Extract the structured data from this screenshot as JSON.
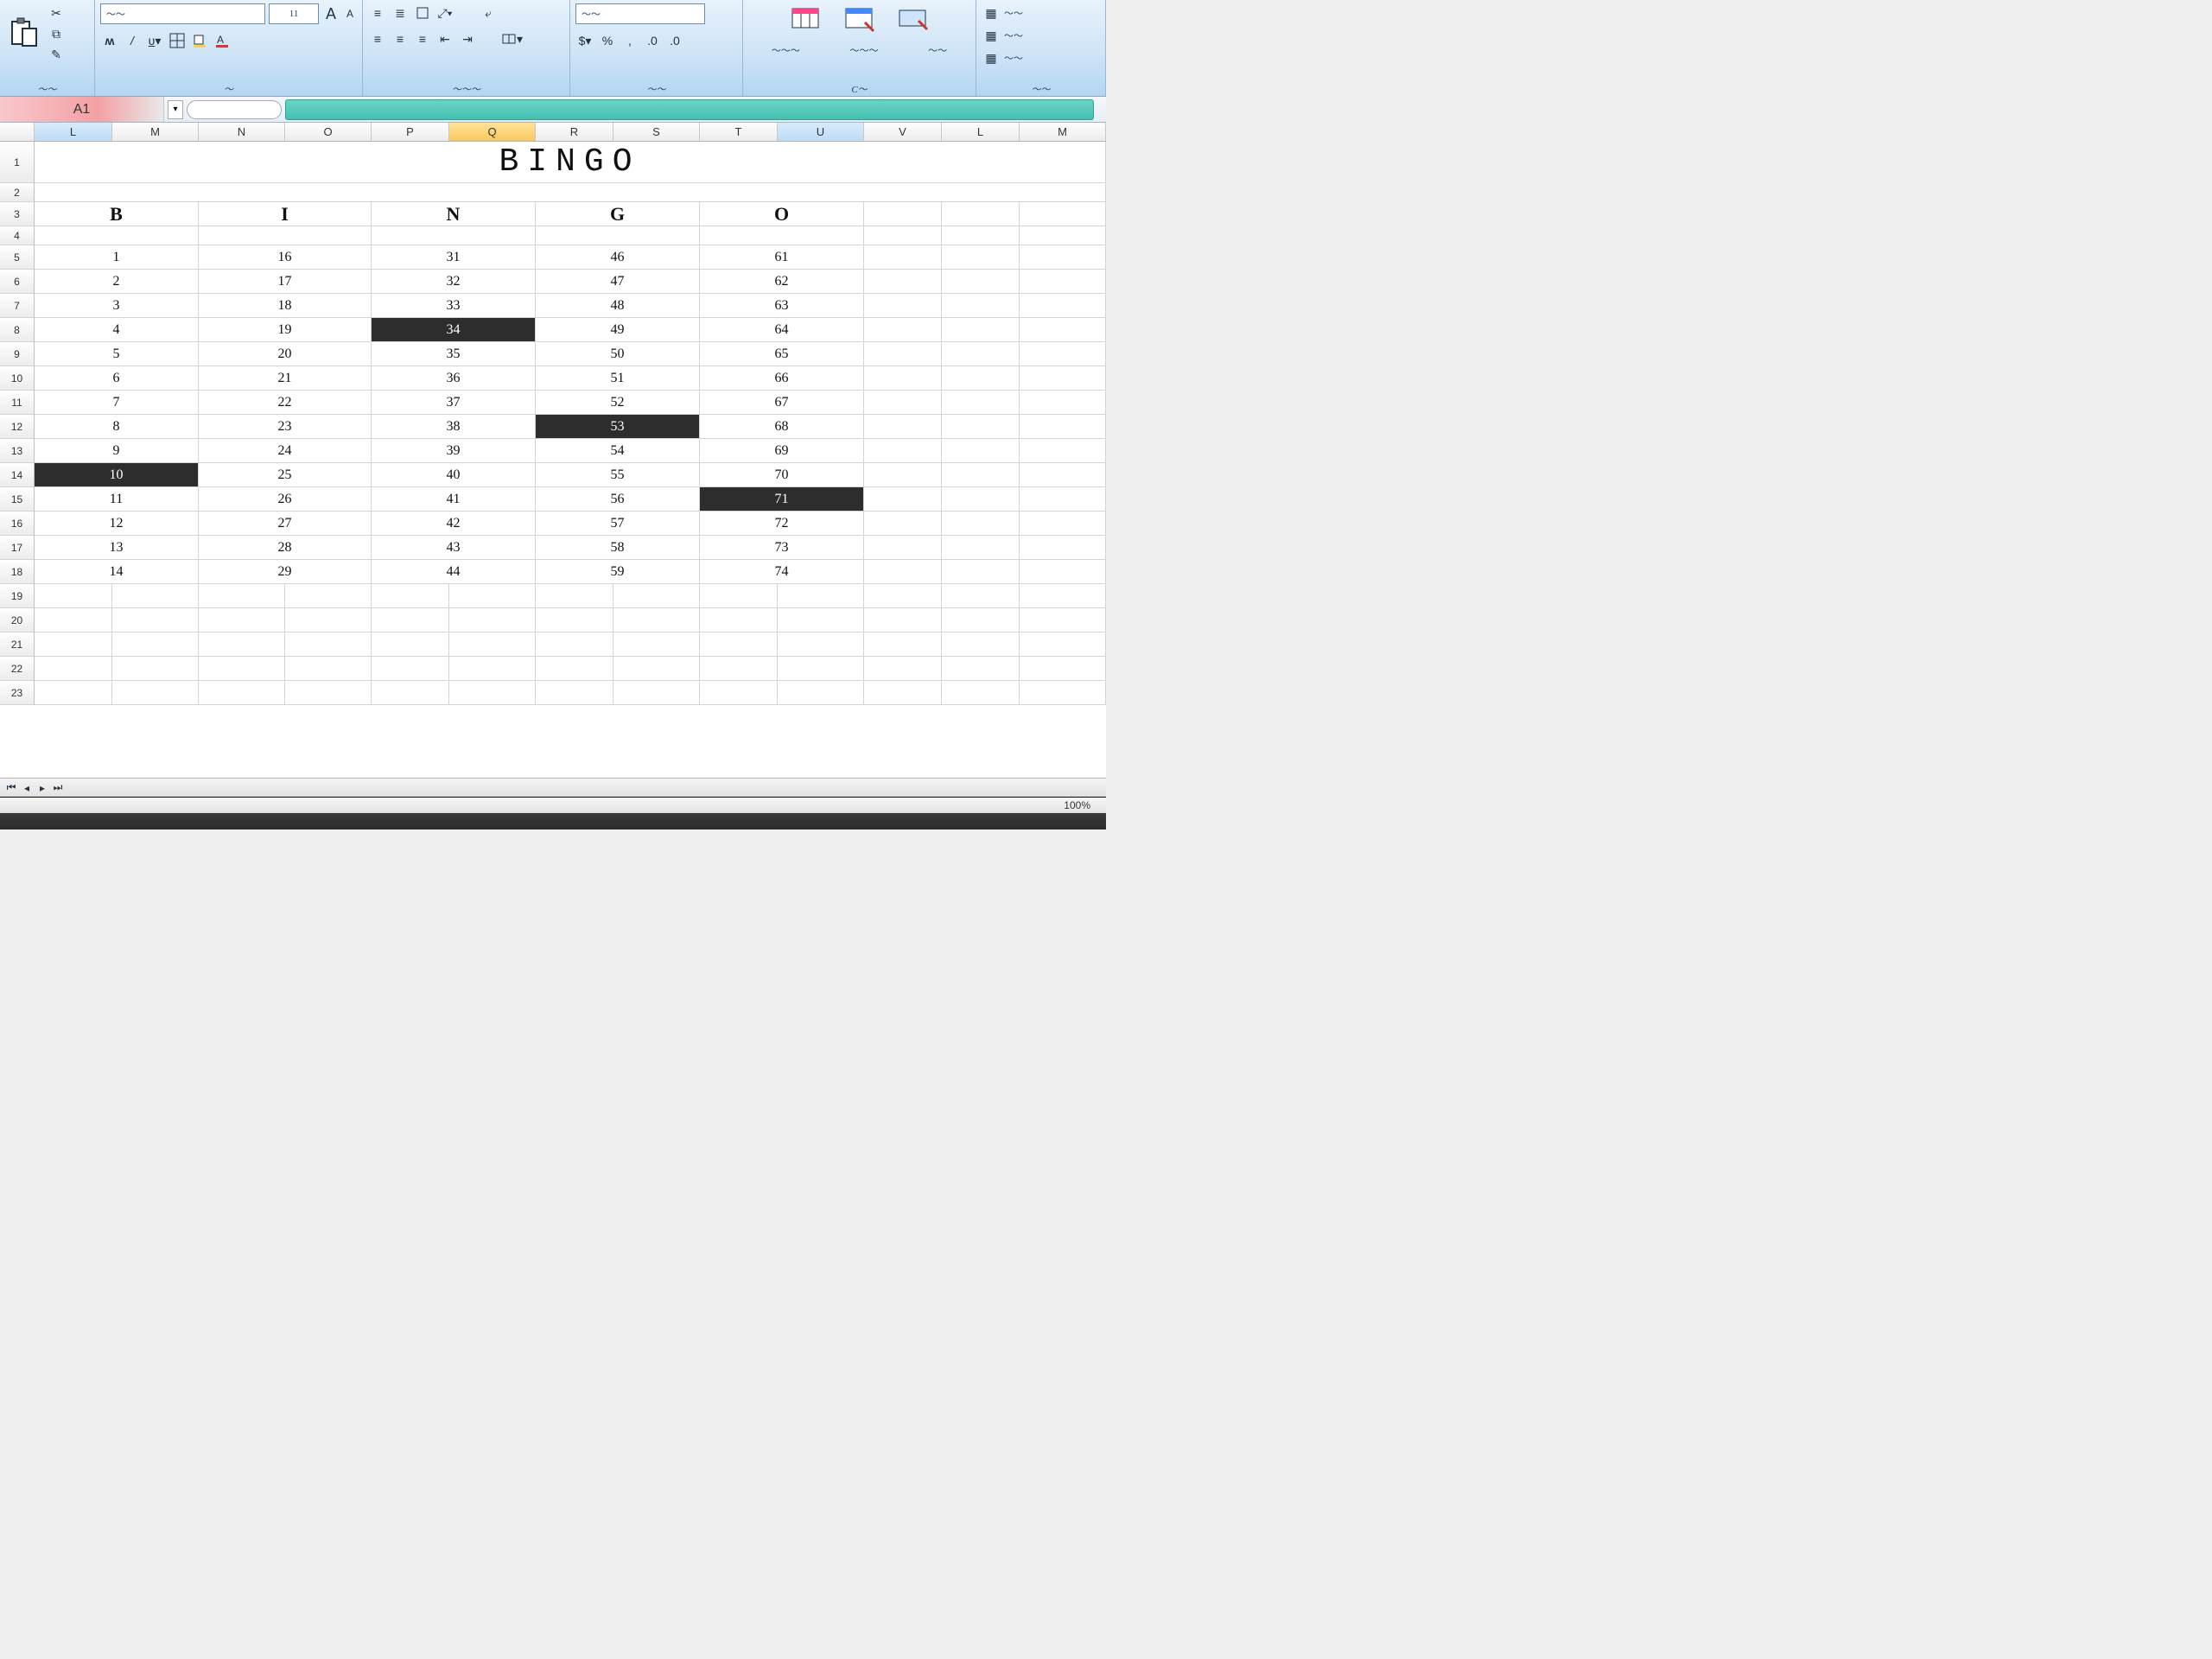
{
  "ribbon": {
    "groups": {
      "clipboard_label": "～～",
      "font_label": "～",
      "align_label": "～～～",
      "number_label": "～～",
      "styles_label": "C～",
      "cells_label": "～～"
    },
    "font_name": "～～",
    "incA": "A",
    "decA": "A",
    "percent": "%"
  },
  "namebox": "A1",
  "columns": [
    {
      "l": "L",
      "w": 90,
      "cls": "bl"
    },
    {
      "l": "M",
      "w": 100,
      "cls": ""
    },
    {
      "l": "N",
      "w": 100,
      "cls": ""
    },
    {
      "l": "O",
      "w": 100,
      "cls": ""
    },
    {
      "l": "P",
      "w": 90,
      "cls": ""
    },
    {
      "l": "Q",
      "w": 100,
      "cls": "hl"
    },
    {
      "l": "R",
      "w": 90,
      "cls": ""
    },
    {
      "l": "S",
      "w": 100,
      "cls": ""
    },
    {
      "l": "T",
      "w": 90,
      "cls": ""
    },
    {
      "l": "U",
      "w": 100,
      "cls": "bl"
    },
    {
      "l": "V",
      "w": 90,
      "cls": ""
    },
    {
      "l": "L",
      "w": 90,
      "cls": ""
    },
    {
      "l": "M",
      "w": 100,
      "cls": ""
    }
  ],
  "row_numbers": [
    "1",
    "2",
    "3",
    "4",
    "5",
    "6",
    "7",
    "8",
    "9",
    "10",
    "11",
    "12",
    "13",
    "14",
    "15",
    "16",
    "17",
    "18",
    "19",
    "20",
    "21",
    "22",
    "23"
  ],
  "title": "BINGO",
  "bingo_headers": [
    "B",
    "I",
    "N",
    "G",
    "O"
  ],
  "bingo_cols": [
    [
      "1",
      "2",
      "3",
      "4",
      "5",
      "6",
      "7",
      "8",
      "9",
      "10",
      "11",
      "12",
      "13",
      "14"
    ],
    [
      "16",
      "17",
      "18",
      "19",
      "20",
      "21",
      "22",
      "23",
      "24",
      "25",
      "26",
      "27",
      "28",
      "29"
    ],
    [
      "31",
      "32",
      "33",
      "34",
      "35",
      "36",
      "37",
      "38",
      "39",
      "40",
      "41",
      "42",
      "43",
      "44"
    ],
    [
      "46",
      "47",
      "48",
      "49",
      "50",
      "51",
      "52",
      "53",
      "54",
      "55",
      "56",
      "57",
      "58",
      "59"
    ],
    [
      "61",
      "62",
      "63",
      "64",
      "65",
      "66",
      "67",
      "68",
      "69",
      "70",
      "71",
      "72",
      "73",
      "74"
    ]
  ],
  "dark_cells": [
    {
      "col": 0,
      "row": 9
    },
    {
      "col": 2,
      "row": 3
    },
    {
      "col": 3,
      "row": 7
    },
    {
      "col": 4,
      "row": 10
    }
  ],
  "zoom": "100%"
}
